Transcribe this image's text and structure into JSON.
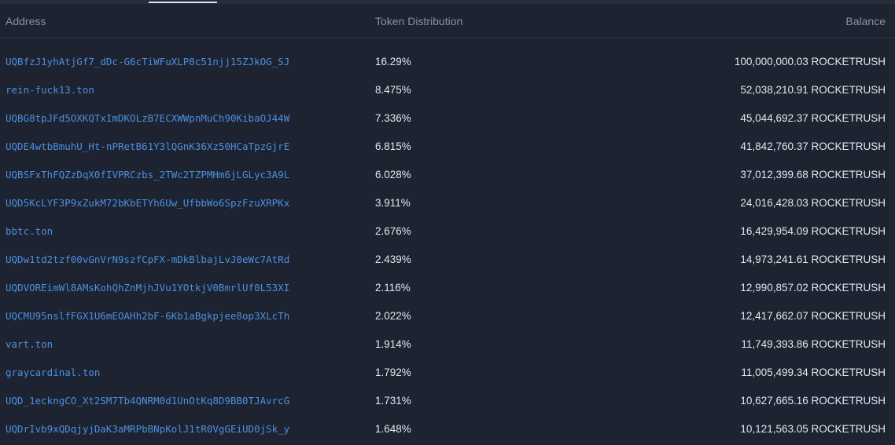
{
  "header": {
    "address_label": "Address",
    "distribution_label": "Token Distribution",
    "balance_label": "Balance"
  },
  "colors": {
    "background": "#1d2330",
    "link": "#4c8fe0",
    "text": "#e4e7ec",
    "muted": "#8b929d"
  },
  "holders": [
    {
      "address": "UQBfzJ1yhAtjGf7_dDc-G6cTiWFuXLP8c51njj15ZJkOG_SJ",
      "share": "16.29%",
      "balance": "100,000,000.03 ROCKETRUSH"
    },
    {
      "address": "rein-fuck13.ton",
      "share": "8.475%",
      "balance": "52,038,210.91 ROCKETRUSH"
    },
    {
      "address": "UQBG8tpJFd5OXKQTxImDKOLzB7ECXWWpnMuCh90KibaOJ44W",
      "share": "7.336%",
      "balance": "45,044,692.37 ROCKETRUSH"
    },
    {
      "address": "UQDE4wtbBmuhU_Ht-nPRetB61Y3lQGnK36Xz50HCaTpzGjrE",
      "share": "6.815%",
      "balance": "41,842,760.37 ROCKETRUSH"
    },
    {
      "address": "UQBSFxThFQZzDqX0fIVPRCzbs_2TWc2TZPMHm6jLGLyc3A9L",
      "share": "6.028%",
      "balance": "37,012,399.68 ROCKETRUSH"
    },
    {
      "address": "UQD5KcLYF3P9xZukM72bKbETYh6Uw_UfbbWo6SpzFzuXRPKx",
      "share": "3.911%",
      "balance": "24,016,428.03 ROCKETRUSH"
    },
    {
      "address": "bbtc.ton",
      "share": "2.676%",
      "balance": "16,429,954.09 ROCKETRUSH"
    },
    {
      "address": "UQDw1td2tzf00vGnVrN9szfCpFX-mDkBlbajLvJ0eWc7AtRd",
      "share": "2.439%",
      "balance": "14,973,241.61 ROCKETRUSH"
    },
    {
      "address": "UQDVOREimWl8AMsKohQhZnMjhJVu1YOtkjV0BmrlUf0L53XI",
      "share": "2.116%",
      "balance": "12,990,857.02 ROCKETRUSH"
    },
    {
      "address": "UQCMU95nslfFGX1U6mEOAHh2bF-6Kb1aBgkpjee8op3XLcTh",
      "share": "2.022%",
      "balance": "12,417,662.07 ROCKETRUSH"
    },
    {
      "address": "vart.ton",
      "share": "1.914%",
      "balance": "11,749,393.86 ROCKETRUSH"
    },
    {
      "address": "graycardinal.ton",
      "share": "1.792%",
      "balance": "11,005,499.34 ROCKETRUSH"
    },
    {
      "address": "UQD_1eckngCO_Xt2SM7Tb4QNRM0d1UnOtKq8D9BB0TJAvrcG",
      "share": "1.731%",
      "balance": "10,627,665.16 ROCKETRUSH"
    },
    {
      "address": "UQDrIvb9xQDqjyjDaK3aMRPbBNpKolJ1tR0VgGEiUD0jSk_y",
      "share": "1.648%",
      "balance": "10,121,563.05 ROCKETRUSH"
    }
  ]
}
